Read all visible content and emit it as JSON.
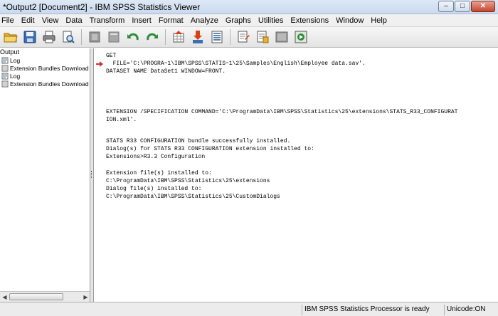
{
  "window": {
    "title": "*Output2 [Document2] - IBM SPSS Statistics Viewer",
    "minimize_label": "–",
    "maximize_label": "□",
    "close_label": "✕"
  },
  "menu": [
    "File",
    "Edit",
    "View",
    "Data",
    "Transform",
    "Insert",
    "Format",
    "Analyze",
    "Graphs",
    "Utilities",
    "Extensions",
    "Window",
    "Help"
  ],
  "toolbar": {
    "icons": [
      "open-folder-icon",
      "save-icon",
      "print-icon",
      "print-preview-icon",
      "export-icon",
      "recall-dialog-icon",
      "undo-icon",
      "redo-icon",
      "goto-data-icon",
      "goto-case-icon",
      "variables-icon",
      "insert-output-icon",
      "insert-text-icon",
      "insert-title-icon",
      "hide-icon",
      "designate-window-icon"
    ]
  },
  "outline": {
    "root": "Output",
    "items": [
      "Log",
      "Extension Bundles Download L",
      "Log",
      "Extension Bundles Download L"
    ]
  },
  "log": {
    "lines": [
      "GET",
      "  FILE='C:\\PROGRA~1\\IBM\\SPSS\\STATIS~1\\25\\Samples\\English\\Employee data.sav'.",
      "DATASET NAME DataSet1 WINDOW=FRONT.",
      "EXTENSION /SPECIFICATION COMMAND='C:\\ProgramData\\IBM\\SPSS\\Statistics\\25\\extensions\\STATS_R33_CONFIGURAT",
      "ION.xml'.",
      "STATS R33 CONFIGURATION bundle successfully installed.",
      "Dialog(s) for STATS R33 CONFIGURATION extension installed to:",
      "Extensions>R3.3 Configuration",
      "Extension file(s) installed to:",
      "C:\\ProgramData\\IBM\\SPSS\\Statistics\\25\\extensions",
      "Dialog file(s) installed to:",
      "C:\\ProgramData\\IBM\\SPSS\\Statistics\\25\\CustomDialogs"
    ]
  },
  "status": {
    "processor": "IBM SPSS Statistics Processor is ready",
    "unicode": "Unicode:ON"
  },
  "colors": {
    "log_arrow": "#d32f2f",
    "title_bar": "#c9d9ee"
  }
}
